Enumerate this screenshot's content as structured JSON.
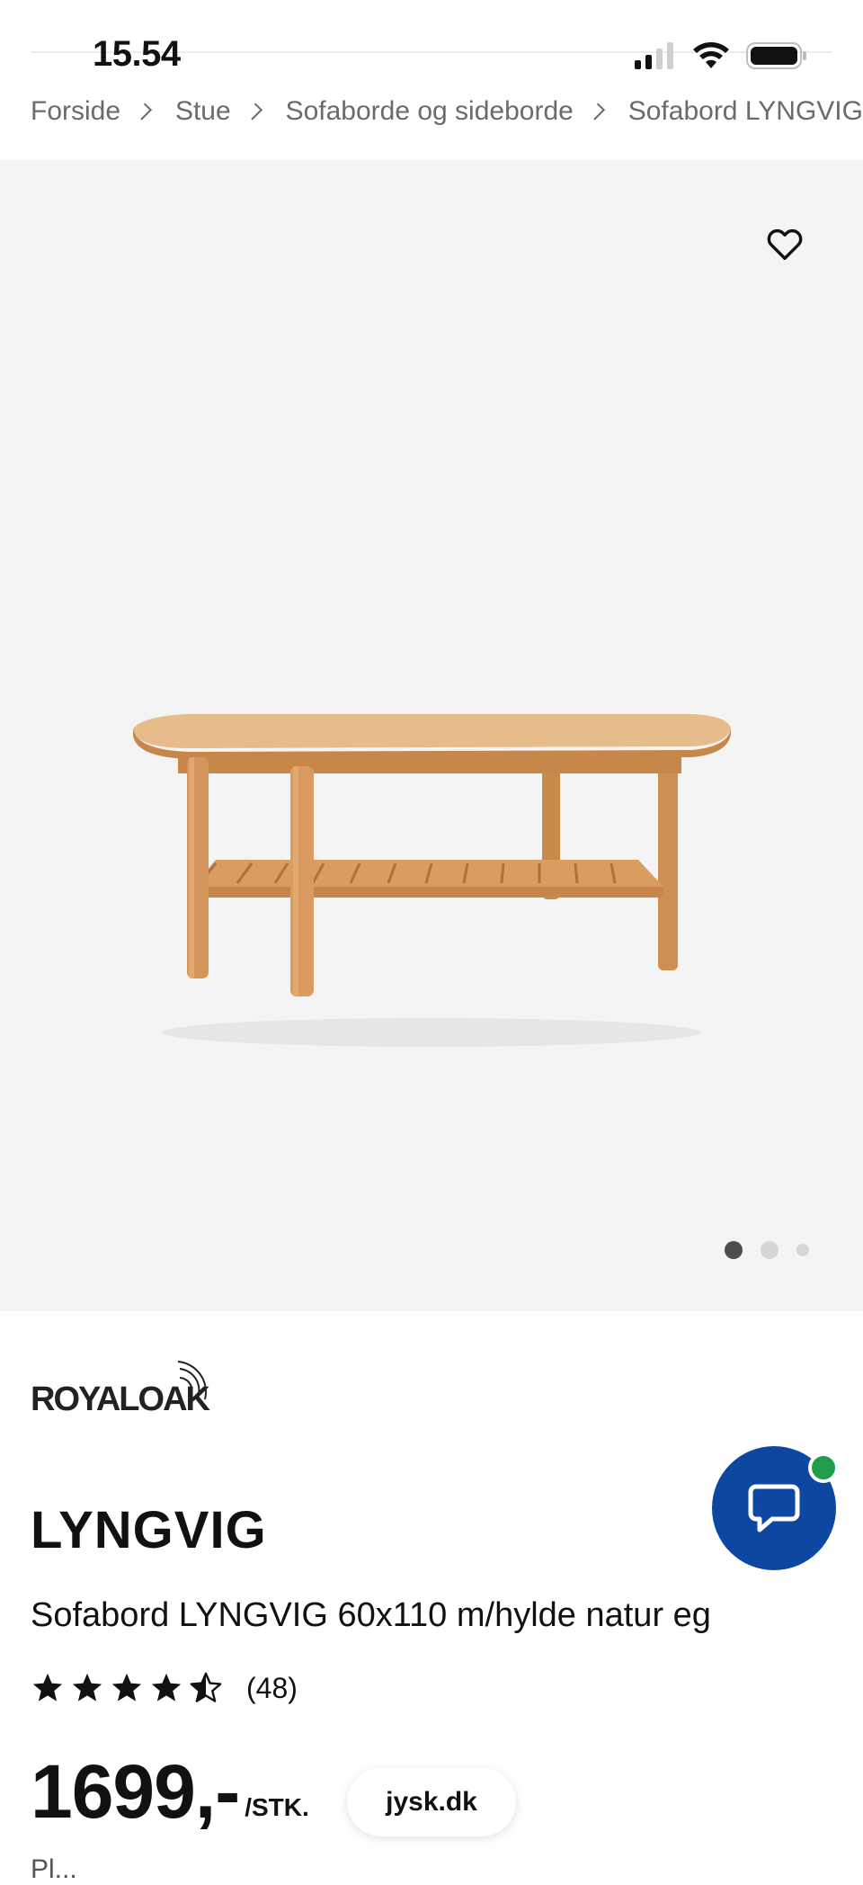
{
  "status_bar": {
    "time": "15.54"
  },
  "breadcrumb": {
    "items": [
      "Forside",
      "Stue",
      "Sofaborde og sideborde",
      "Sofabord LYNGVIG"
    ]
  },
  "gallery": {
    "favorite_icon": "heart-outline-icon",
    "dots_total": 3,
    "active_dot": 1
  },
  "brand": {
    "name": "ROYALOAK"
  },
  "product": {
    "name": "LYNGVIG",
    "description": "Sofabord LYNGVIG 60x110 m/hylde natur eg",
    "rating": 4.5,
    "rating_count": "(48)",
    "price": "1699,-",
    "unit": "/STK.",
    "partial_text": "Pl..."
  },
  "chat": {
    "icon": "chat-bubble-icon",
    "badge_color": "#1f9d4a",
    "button_color": "#0d47a1"
  },
  "site_pill": {
    "label": "jysk.dk"
  }
}
